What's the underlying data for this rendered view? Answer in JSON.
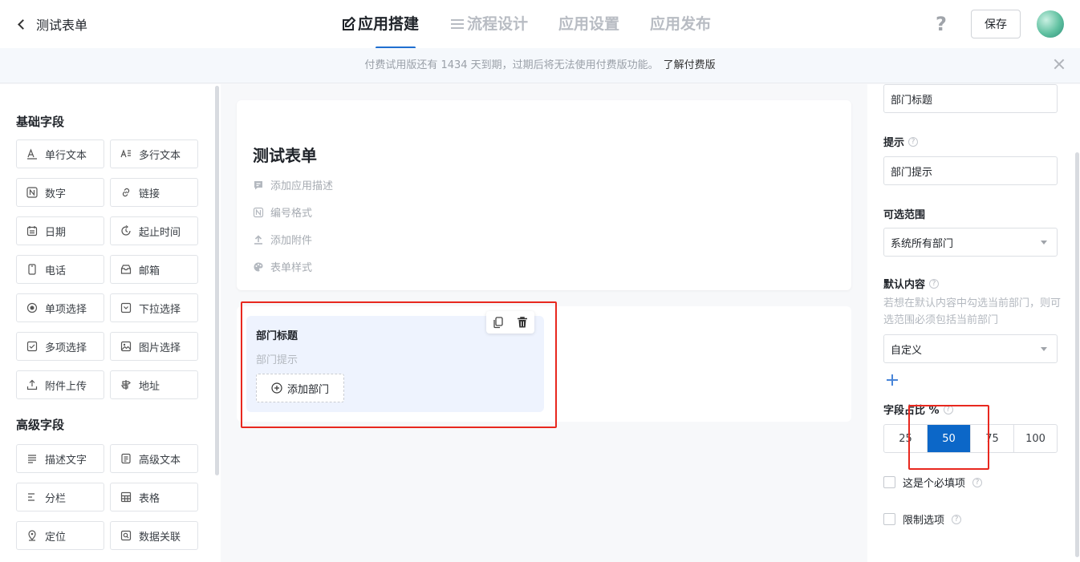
{
  "header": {
    "back_title": "测试表单",
    "tabs": [
      {
        "label": "应用搭建"
      },
      {
        "label": "流程设计"
      },
      {
        "label": "应用设置"
      },
      {
        "label": "应用发布"
      }
    ],
    "help": "?",
    "save_label": "保存"
  },
  "notice": {
    "text": "付费试用版还有 1434 天到期，过期后将无法使用付费版功能。",
    "link": "了解付费版"
  },
  "left_panel": {
    "basic_title": "基础字段",
    "basic_fields": [
      "单行文本",
      "多行文本",
      "数字",
      "链接",
      "日期",
      "起止时间",
      "电话",
      "邮箱",
      "单项选择",
      "下拉选择",
      "多项选择",
      "图片选择",
      "附件上传",
      "地址"
    ],
    "advanced_title": "高级字段",
    "advanced_fields": [
      "描述文字",
      "高级文本",
      "分栏",
      "表格",
      "定位",
      "数据关联"
    ]
  },
  "canvas": {
    "form_title": "测试表单",
    "meta": [
      "添加应用描述",
      "编号格式",
      "添加附件",
      "表单样式"
    ],
    "field": {
      "label": "部门标题",
      "hint": "部门提示",
      "add_button": "添加部门"
    }
  },
  "right_panel": {
    "title_value": "部门标题",
    "hint_label": "提示",
    "hint_value": "部门提示",
    "range_label": "可选范围",
    "range_value": "系统所有部门",
    "default_label": "默认内容",
    "default_desc": "若想在默认内容中勾选当前部门，则可选范围必须包括当前部门",
    "default_value": "自定义",
    "width_label": "字段占比 %",
    "width_options": [
      "25",
      "50",
      "75",
      "100"
    ],
    "width_selected": "50",
    "required_label": "这是个必填项",
    "limit_label": "限制选项"
  },
  "colors": {
    "accent": "#1f6fd0",
    "selected": "#0c67c8",
    "highlight": "#e8281f",
    "field_bg": "#eef3fe"
  }
}
